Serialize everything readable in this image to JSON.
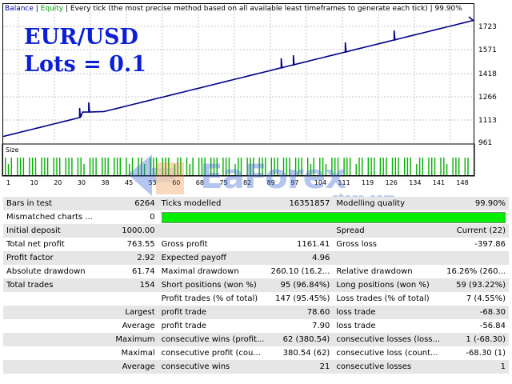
{
  "legend": {
    "balance": "Balance",
    "sep1": " | ",
    "equity": "Equity",
    "rest": " | Every tick (the most precise method based on all available least timeframes to generate each tick) | 99.90%"
  },
  "overlay": {
    "line1": "EUR/USD",
    "line2": "Lots = 0.1"
  },
  "size_label": "Size",
  "watermark": {
    "text": "EaForex",
    "sub": "store.com"
  },
  "colors": {
    "balance": "#00008b",
    "size_bars": "#00b000",
    "quality_bar": "#00ee00",
    "row_alt": "#e6e6e6"
  },
  "chart_data": {
    "type": "line",
    "series": [
      {
        "name": "Balance",
        "x": [
          0,
          27,
          33,
          154
        ],
        "y": [
          1000,
          1163,
          1163,
          1761
        ]
      }
    ],
    "y_ticks": [
      "1723",
      "1571",
      "1418",
      "1266",
      "1113",
      "961"
    ],
    "x_ticks": [
      "1",
      "10",
      "20",
      "30",
      "38",
      "45",
      "53",
      "60",
      "68",
      "75",
      "82",
      "89",
      "97",
      "104",
      "111",
      "119",
      "126",
      "134",
      "141",
      "148"
    ],
    "spikes_x": [
      25,
      28,
      91,
      95,
      112,
      128
    ]
  },
  "report": {
    "rows": [
      [
        "Bars in test",
        "6264",
        "Ticks modelled",
        "16351857",
        "Modelling quality",
        "99.90%"
      ],
      [
        "Mismatched charts ...",
        "0",
        "",
        "",
        "",
        ""
      ],
      [
        "Initial deposit",
        "1000.00",
        "",
        "",
        "Spread",
        "Current (22)"
      ],
      [
        "Total net profit",
        "763.55",
        "Gross profit",
        "1161.41",
        "Gross loss",
        "-397.86"
      ],
      [
        "Profit factor",
        "2.92",
        "Expected payoff",
        "4.96",
        "",
        ""
      ],
      [
        "Absolute drawdown",
        "61.74",
        "Maximal drawdown",
        "260.10 (16.2...",
        "Relative drawdown",
        "16.26% (260..."
      ],
      [
        "Total trades",
        "154",
        "Short positions (won %)",
        "95 (96.84%)",
        "Long positions (won %)",
        "59 (93.22%)"
      ],
      [
        "",
        "",
        "Profit trades (% of total)",
        "147 (95.45%)",
        "Loss trades (% of total)",
        "7 (4.55%)"
      ],
      [
        "",
        "Largest",
        "profit trade",
        "78.60",
        "loss trade",
        "-68.30"
      ],
      [
        "",
        "Average",
        "profit trade",
        "7.90",
        "loss trade",
        "-56.84"
      ],
      [
        "",
        "Maximum",
        "consecutive wins (profit...",
        "62 (380.54)",
        "consecutive losses (loss...",
        "1 (-68.30)"
      ],
      [
        "",
        "Maximal",
        "consecutive profit (cou...",
        "380.54 (62)",
        "consecutive loss (count...",
        "-68.30 (1)"
      ],
      [
        "",
        "Average",
        "consecutive wins",
        "21",
        "consecutive losses",
        "1"
      ]
    ]
  }
}
